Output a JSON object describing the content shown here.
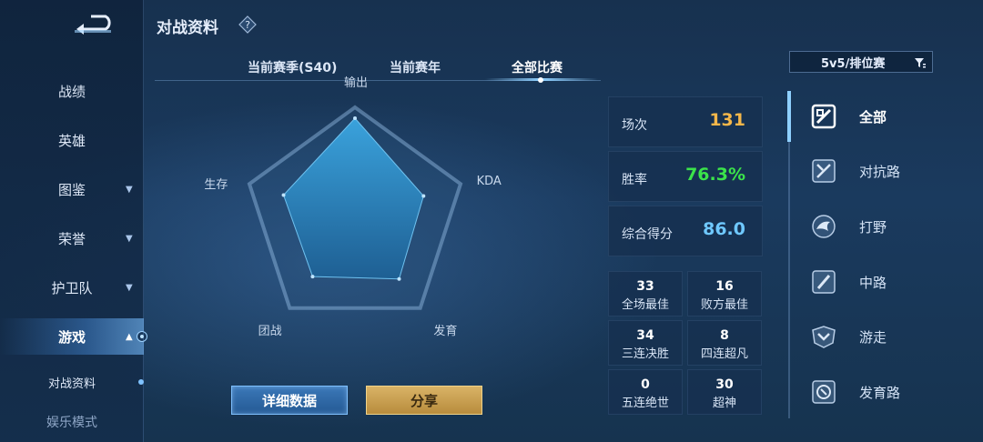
{
  "header": {
    "title": "对战资料"
  },
  "sidebar": {
    "items": [
      {
        "label": "战绩",
        "expandable": false
      },
      {
        "label": "英雄",
        "expandable": false
      },
      {
        "label": "图鉴",
        "expandable": true
      },
      {
        "label": "荣誉",
        "expandable": true
      },
      {
        "label": "护卫队",
        "expandable": true
      },
      {
        "label": "游戏",
        "expandable": true,
        "expanded": true,
        "active": true
      },
      {
        "label": "对战资料",
        "sub": true
      },
      {
        "label": "娱乐模式",
        "sub": true
      }
    ]
  },
  "tabs": [
    {
      "label": "当前赛季(S40)"
    },
    {
      "label": "当前赛年"
    },
    {
      "label": "全部比赛",
      "active": true
    }
  ],
  "filter": {
    "label": "5v5/排位赛"
  },
  "radar": {
    "axes": [
      "输出",
      "KDA",
      "发育",
      "团战",
      "生存"
    ],
    "values": [
      1.0,
      0.72,
      0.75,
      0.72,
      0.75
    ]
  },
  "buttons": {
    "detail": "详细数据",
    "share": "分享"
  },
  "stats": {
    "matches": {
      "label": "场次",
      "value": "131",
      "color": "#f5b74a"
    },
    "winrate": {
      "label": "胜率",
      "value": "76.3%",
      "color": "#3be34a"
    },
    "score": {
      "label": "综合得分",
      "value": "86.0",
      "color": "#6fc8ff"
    }
  },
  "achievements": [
    {
      "value": "33",
      "label": "全场最佳"
    },
    {
      "value": "16",
      "label": "败方最佳"
    },
    {
      "value": "34",
      "label": "三连决胜"
    },
    {
      "value": "8",
      "label": "四连超凡"
    },
    {
      "value": "0",
      "label": "五连绝世"
    },
    {
      "value": "30",
      "label": "超神"
    }
  ],
  "roles": [
    {
      "label": "全部",
      "icon": "all-roles-icon",
      "active": true
    },
    {
      "label": "对抗路",
      "icon": "clash-lane-icon"
    },
    {
      "label": "打野",
      "icon": "jungle-icon"
    },
    {
      "label": "中路",
      "icon": "mid-lane-icon"
    },
    {
      "label": "游走",
      "icon": "roam-icon"
    },
    {
      "label": "发育路",
      "icon": "farm-lane-icon"
    }
  ],
  "colors": {
    "accent": "#8fd0ff",
    "gold": "#d9b366",
    "radar_fill": "#2d8ac4"
  }
}
